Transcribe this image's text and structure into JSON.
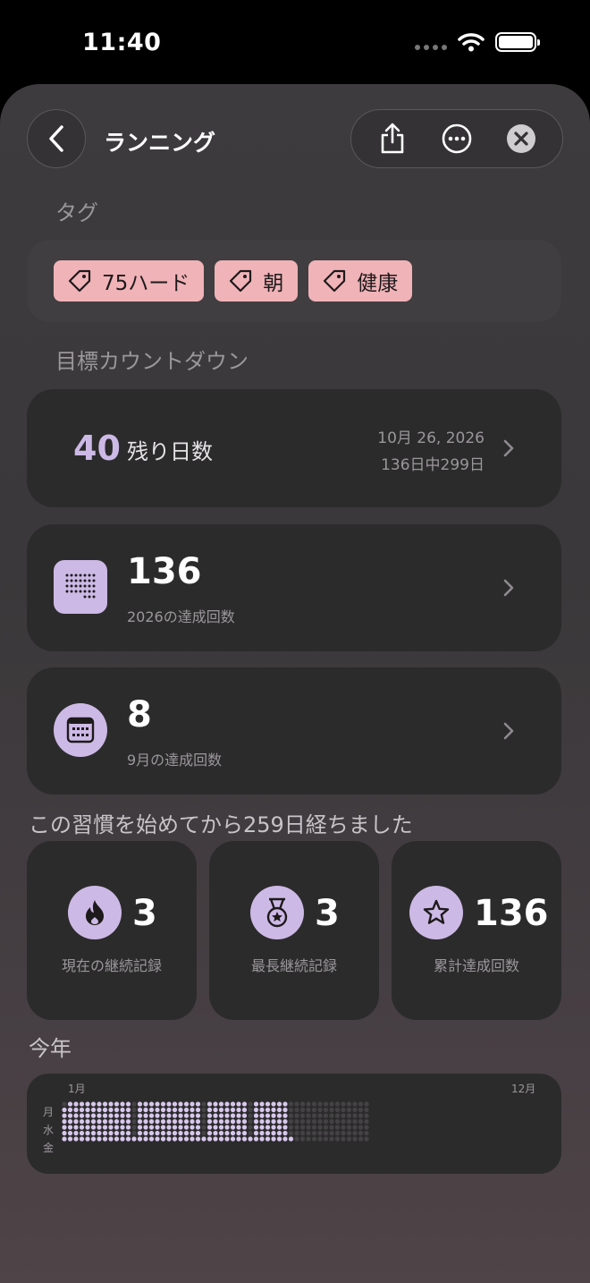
{
  "status": {
    "time": "11:40"
  },
  "header": {
    "title": "ランニング"
  },
  "tags_section": {
    "label": "タグ",
    "tags": [
      "75ハード",
      "朝",
      "健康"
    ]
  },
  "countdown_section": {
    "label": "目標カウントダウン",
    "days": "40",
    "days_label": "残り日数",
    "target_date": "10月 26, 2026",
    "progress_text": "136日中299日"
  },
  "stats": [
    {
      "value": "136",
      "label": "2026の達成回数",
      "icon": "dot-grid-icon"
    },
    {
      "value": "8",
      "label": "9月の達成回数",
      "icon": "calendar-icon"
    }
  ],
  "since_text": "この習慣を始めてから259日経ちました",
  "streaks": [
    {
      "value": "3",
      "label": "現在の継続記録",
      "icon": "flame-icon"
    },
    {
      "value": "3",
      "label": "最長継続記録",
      "icon": "medal-icon"
    },
    {
      "value": "136",
      "label": "累計達成回数",
      "icon": "star-icon"
    }
  ],
  "year_section": {
    "label": "今年",
    "month_start": "1月",
    "month_end": "12月",
    "day_labels": [
      "月",
      "水",
      "金"
    ]
  },
  "colors": {
    "accent": "#cdb9e6",
    "tag_bg": "#f0b3b8",
    "card_bg": "#2c2b2c"
  }
}
